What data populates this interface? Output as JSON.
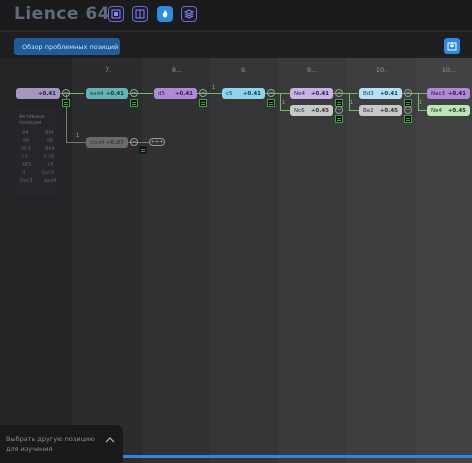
{
  "app": {
    "logo": "Lience 64"
  },
  "toolbar": {
    "icons": [
      "board-icon",
      "layout-icon",
      "flame-icon",
      "stack-icon"
    ]
  },
  "subheader": {
    "pill_label": "Обзор проблемных позиций",
    "download_icon": "download-icon"
  },
  "columns": [
    "7.",
    "8...",
    "9.",
    "9...",
    "10.",
    "10..."
  ],
  "nodes": {
    "first": {
      "move": "",
      "score": "+0.41"
    },
    "main": [
      {
        "move": "exd4",
        "score": "+0.41"
      },
      {
        "move": "d5",
        "score": "+0.41"
      },
      {
        "move": "c5",
        "score": "+0.41"
      },
      {
        "move": "Ne4",
        "score": "+0.41"
      },
      {
        "move": "Bd3",
        "score": "+0.41"
      },
      {
        "move": "Nac3",
        "score": "+0.41"
      }
    ],
    "alt": [
      {
        "move": "Nc6",
        "score": "+0.45"
      },
      {
        "move": "Be2",
        "score": "+0.45"
      },
      {
        "move": "Ne4",
        "score": "+0.45"
      }
    ],
    "side": {
      "move": "Qxd4",
      "score": "+0.07"
    }
  },
  "branch_numbers": [
    "1",
    "1",
    "1",
    "1",
    "1"
  ],
  "plus_label": "+++",
  "panel": {
    "title": "Активные позиции",
    "rows": [
      [
        "e4",
        "Bf4"
      ],
      [
        "d4",
        "d5"
      ],
      [
        "Nc3",
        "Bb4"
      ],
      [
        "c3",
        "b c6"
      ],
      [
        "Nf3",
        "c5"
      ],
      [
        "d",
        "Qxc3"
      ],
      [
        "Qxc3",
        "exd4"
      ]
    ]
  },
  "bottom": {
    "text": "Выбрать другую позицию для изучения"
  }
}
